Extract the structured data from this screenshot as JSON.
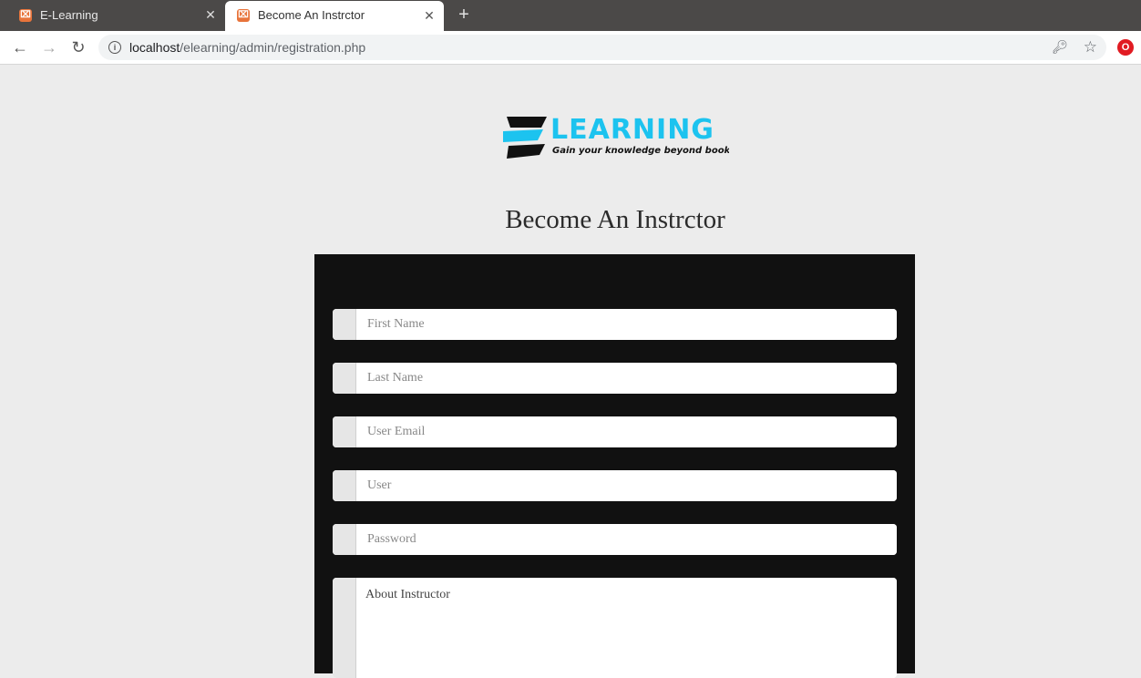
{
  "browser": {
    "tabs": [
      {
        "title": "E-Learning",
        "icon": "xampp-favicon-icon",
        "active": false
      },
      {
        "title": "Become An Instrctor",
        "icon": "xampp-favicon-icon",
        "active": true
      }
    ],
    "new_tab_symbol": "+",
    "url_host": "localhost",
    "url_path": "/elearning/admin/registration.php"
  },
  "page": {
    "logo": {
      "word": "LEARNING",
      "tagline": "Gain your knowledge beyond books",
      "accent_color": "#1cc3ef"
    },
    "title": "Become An Instrctor",
    "form": {
      "first_name_placeholder": "First Name",
      "last_name_placeholder": "Last Name",
      "email_placeholder": "User Email",
      "user_placeholder": "User",
      "password_placeholder": "Password",
      "about_placeholder": "About Instructor"
    }
  }
}
